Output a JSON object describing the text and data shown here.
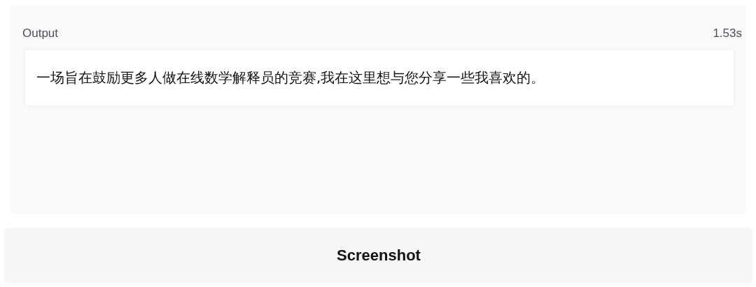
{
  "output": {
    "label": "Output",
    "time": "1.53s",
    "text": "一场旨在鼓励更多人做在线数学解释员的竞赛,我在这里想与您分享一些我喜欢的。"
  },
  "buttons": [
    {
      "label": "Screenshot"
    }
  ]
}
